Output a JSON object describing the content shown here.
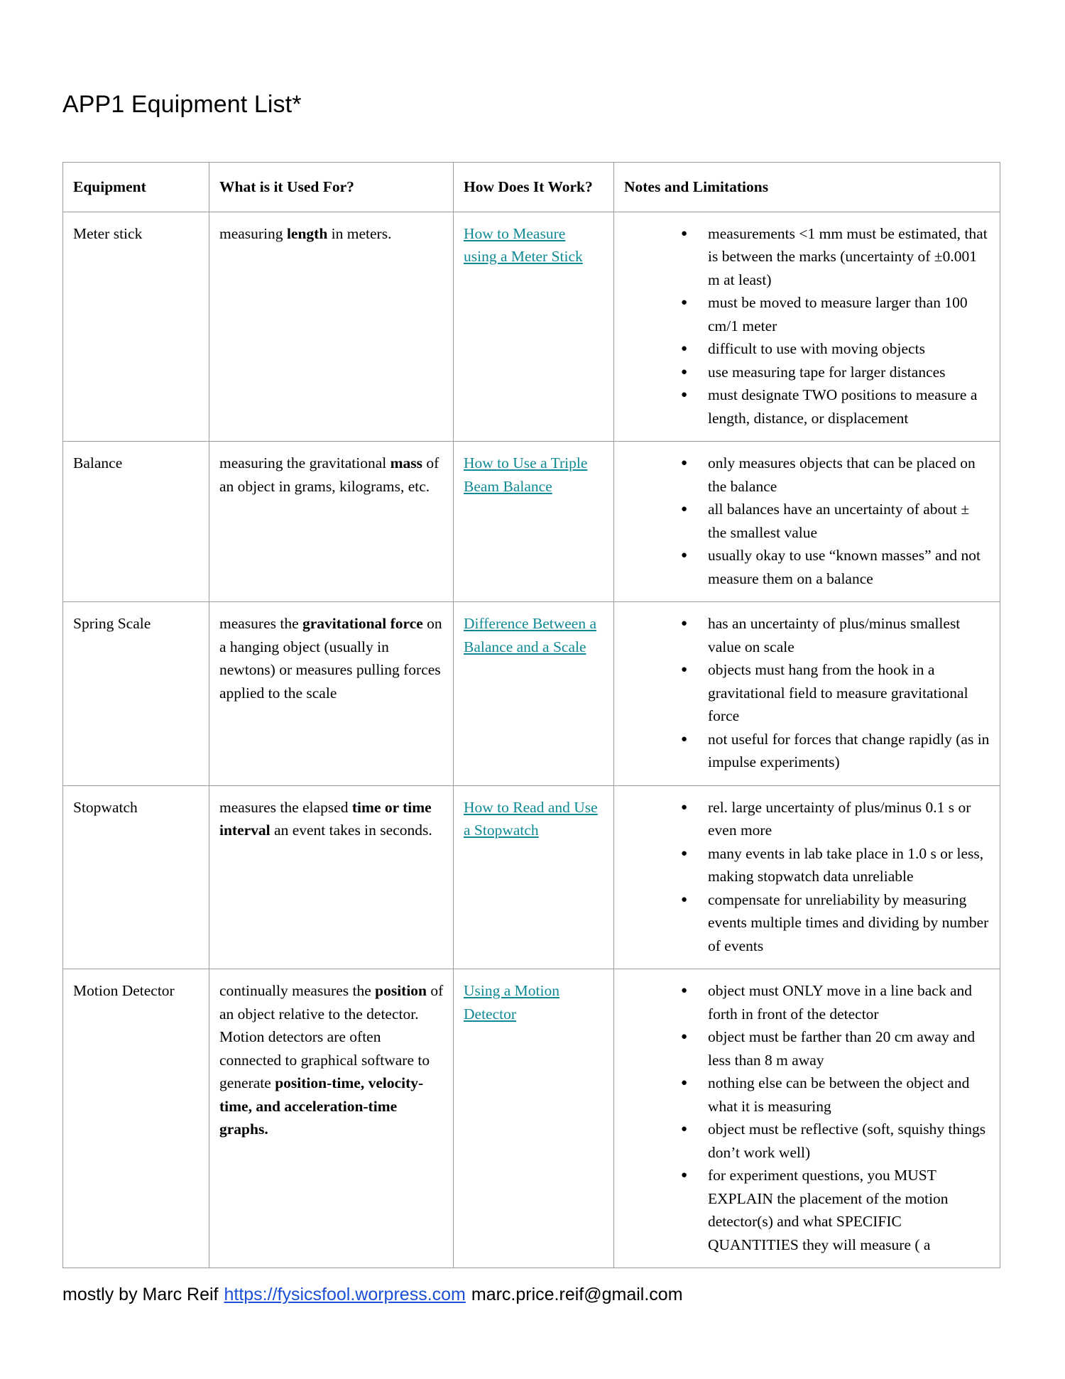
{
  "document": {
    "title": "APP1 Equipment List*"
  },
  "table": {
    "headers": {
      "equipment": "Equipment",
      "used_for": "What is it Used For?",
      "how_works": "How Does It Work?",
      "notes": "Notes and Limitations"
    },
    "rows": [
      {
        "equipment": "Meter stick",
        "used_for_pre": "measuring ",
        "used_for_bold": "length",
        "used_for_post": " in meters.",
        "link_line1": "How to Measure",
        "link_line2": "using a Meter Stick",
        "notes": [
          "measurements <1 mm must be estimated, that is between the marks (uncertainty of ±0.001 m at least)",
          "must be moved to measure larger than 100 cm/1 meter",
          "difficult to use with moving objects",
          "use measuring tape for larger distances",
          "must designate TWO positions to measure a length, distance, or displacement"
        ]
      },
      {
        "equipment": "Balance",
        "used_for_pre": "measuring the gravitational ",
        "used_for_bold": "mass",
        "used_for_post": " of an object in grams, kilograms, etc.",
        "link_line1": "How to Use a Triple",
        "link_line2": "Beam Balance",
        "notes": [
          "only measures objects that can be placed on the balance",
          "all balances have an uncertainty of about ± the smallest value",
          "usually okay to use “known masses” and not measure them on a balance"
        ]
      },
      {
        "equipment": "Spring Scale",
        "used_for_pre": "measures the ",
        "used_for_bold": "gravitational force",
        "used_for_post": " on a hanging object (usually in newtons) or measures pulling forces applied to the scale",
        "link_line1": "Difference Between a",
        "link_line2": "Balance and a Scale",
        "notes": [
          "has an uncertainty of plus/minus smallest value on scale",
          "objects must hang from the hook in a gravitational field to measure gravitational force",
          "not useful for forces that change rapidly (as in impulse experiments)"
        ]
      },
      {
        "equipment": "Stopwatch",
        "used_for_pre": "measures the elapsed ",
        "used_for_bold": "time or time interval",
        "used_for_post": " an event takes in seconds.",
        "link_line1": "How to Read and Use",
        "link_line2": "a Stopwatch",
        "notes": [
          "rel. large uncertainty of plus/minus 0.1 s or even more",
          "many events in lab take place in 1.0 s or less, making stopwatch data unreliable",
          "compensate for unreliability by measuring events multiple times and dividing by number of events"
        ]
      },
      {
        "equipment": "Motion Detector",
        "used_for_pre": "continually measures the ",
        "used_for_bold": "position",
        "used_for_post": " of an object relative to the detector. Motion detectors are often connected to graphical software to generate ",
        "used_for_bold2": "position-time, velocity-time, and acceleration-time graphs.",
        "link_line1": "Using a Motion",
        "link_line2": "Detector",
        "notes": [
          "object must ONLY move in a line back and forth in front of the detector",
          "object must be farther than 20 cm away and less than 8 m away",
          "nothing else can be between the object and what it is measuring",
          "object must be reflective (soft, squishy things don’t work well)",
          "for experiment questions, you MUST EXPLAIN the placement of the motion detector(s) and what SPECIFIC QUANTITIES they will measure ( a"
        ]
      }
    ]
  },
  "footer": {
    "credit": "mostly by Marc Reif",
    "url": "https://fysicsfool.worpress.com",
    "email": "marc.price.reif@gmail.com"
  },
  "colors": {
    "link_teal": "#0f8a94",
    "link_blue": "#1a4fd6",
    "border": "#9b9b9b"
  }
}
